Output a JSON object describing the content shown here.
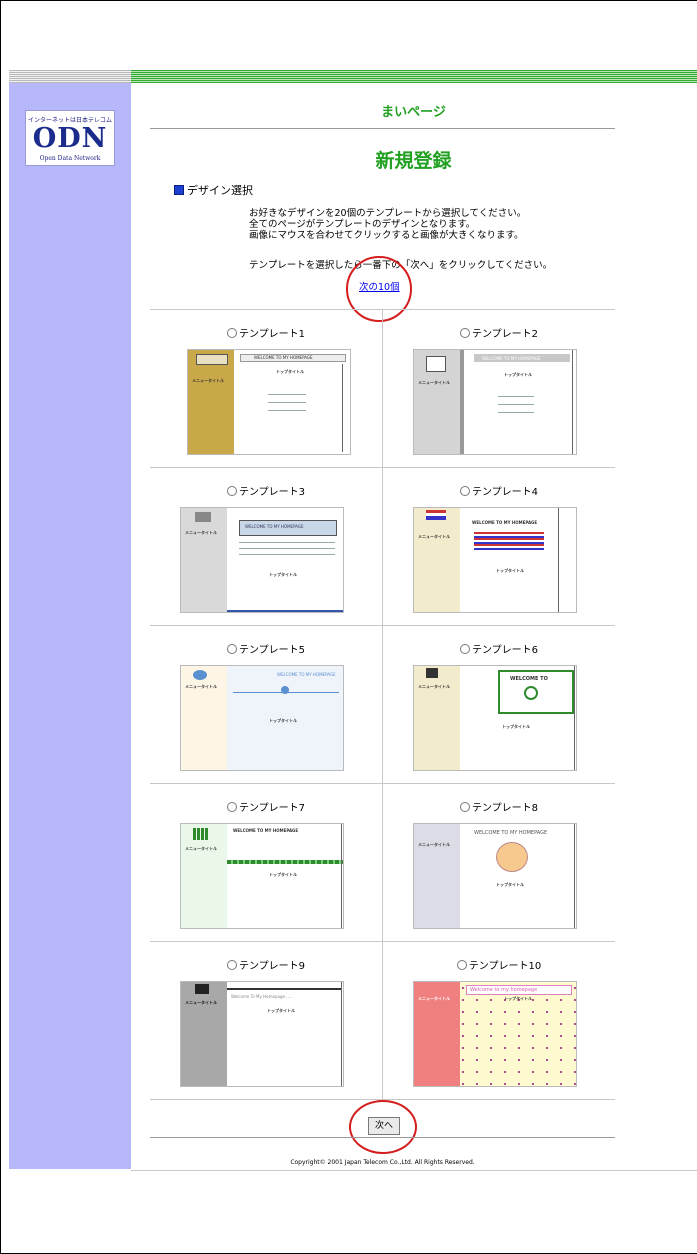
{
  "header": {
    "mypage": "まいページ",
    "title": "新規登録"
  },
  "logo": {
    "top_text": "インターネットは日本テレコム",
    "mark": "ODN",
    "sub_text": "Open Data Network"
  },
  "section": {
    "label": "デザイン選択"
  },
  "instructions": {
    "lines": [
      "お好きなデザインを20個のテンプレートから選択してください。",
      "全てのページがテンプレートのデザインとなります。",
      "画像にマウスを合わせてクリックすると画像が大きくなります。"
    ],
    "line2": "テンプレートを選択したら一番下の「次へ」をクリックしてください。",
    "next_ten_link": "次の10個"
  },
  "templates": [
    {
      "label": "テンプレート1",
      "thumb": {
        "banner": "WELCOME TO MY HOMEPAGE",
        "heading": "トップタイトル",
        "menu_title": "メニュータイトル"
      }
    },
    {
      "label": "テンプレート2",
      "thumb": {
        "banner": "WELCOME TO MY HOMEPAGE",
        "heading": "トップタイトル",
        "menu_title": "メニュータイトル"
      }
    },
    {
      "label": "テンプレート3",
      "thumb": {
        "banner": "WELCOME TO MY HOMEPAGE",
        "heading": "トップタイトル",
        "menu_title": "メニュータイトル"
      }
    },
    {
      "label": "テンプレート4",
      "thumb": {
        "banner": "WELCOME TO MY HOMEPAGE",
        "heading": "トップタイトル",
        "menu_title": "メニュータイトル"
      }
    },
    {
      "label": "テンプレート5",
      "thumb": {
        "banner": "WELCOME TO MY HOMEPAGE",
        "heading": "トップタイトル",
        "menu_title": "メニュータイトル"
      }
    },
    {
      "label": "テンプレート6",
      "thumb": {
        "banner": "WELCOME TO",
        "heading": "トップタイトル",
        "menu_title": "メニュータイトル"
      }
    },
    {
      "label": "テンプレート7",
      "thumb": {
        "banner": "WELCOME TO MY HOMEPAGE",
        "heading": "トップタイトル",
        "menu_title": "メニュータイトル"
      }
    },
    {
      "label": "テンプレート8",
      "thumb": {
        "banner": "WELCOME TO MY HOMEPAGE",
        "heading": "トップタイトル",
        "menu_title": "メニュータイトル"
      }
    },
    {
      "label": "テンプレート9",
      "thumb": {
        "banner": "Welcome To My Homepage......",
        "heading": "トップタイトル",
        "menu_title": "メニュータイトル"
      }
    },
    {
      "label": "テンプレート10",
      "thumb": {
        "banner": "Welcome to my homepage",
        "heading": "トップタイトル",
        "menu_title": "メニュータイトル"
      }
    }
  ],
  "footer": {
    "next_button": "次へ",
    "copyright": "Copyright© 2001 Japan Telecom Co.,Ltd. All Rights Reserved."
  },
  "colors": {
    "sidebar": "#b7b7fb",
    "accent_green": "#22a022",
    "highlight_circle": "#d41d1d",
    "link": "#0000ee"
  }
}
